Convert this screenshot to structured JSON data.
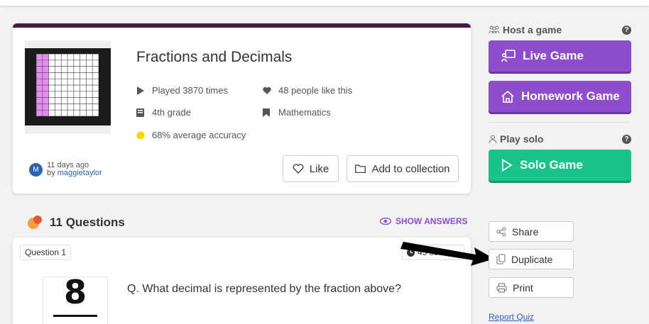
{
  "quiz": {
    "title": "Fractions and Decimals",
    "played": "Played 3870 times",
    "likes": "48 people like this",
    "grade": "4th grade",
    "subject": "Mathematics",
    "accuracy": "68% average accuracy",
    "accent_color": "#461a42",
    "accuracy_dot_color": "#f5d800"
  },
  "author": {
    "avatar_letter": "M",
    "time": "11 days ago",
    "by_prefix": "by",
    "name": "maggietaylor"
  },
  "actions": {
    "like_label": "Like",
    "collection_label": "Add to collection"
  },
  "questions": {
    "count_label": "11 Questions",
    "show_answers": "SHOW ANSWERS",
    "first": {
      "label": "Question 1",
      "time": "45 sec",
      "text": "Q. What decimal is represented by the fraction above?",
      "image_numerator": "8"
    }
  },
  "sidebar": {
    "host_label": "Host a game",
    "live_game": "Live Game",
    "homework_game": "Homework Game",
    "solo_label": "Play solo",
    "solo_game": "Solo Game",
    "share": "Share",
    "duplicate": "Duplicate",
    "print": "Print",
    "report": "Report Quiz",
    "help_glyph": "?",
    "purple": "#8e4dcd",
    "green": "#19c38a"
  }
}
